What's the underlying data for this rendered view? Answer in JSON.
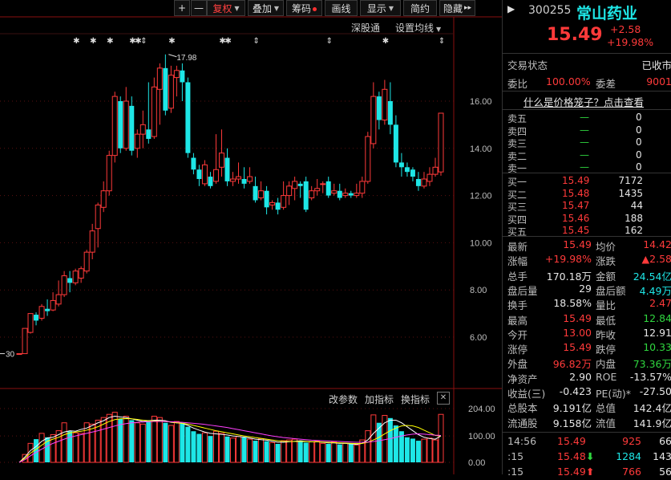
{
  "toolbar": {
    "buttons": [
      {
        "label": "+",
        "name": "zoom-in-button"
      },
      {
        "label": "—",
        "name": "zoom-out-button"
      },
      {
        "label": "复权",
        "name": "adjust-button",
        "caret": true
      },
      {
        "label": "叠加",
        "name": "overlay-button",
        "caret": true
      },
      {
        "label": "筹码",
        "name": "chips-button",
        "dot": true
      },
      {
        "label": "画线",
        "name": "draw-line-button"
      },
      {
        "label": "显示",
        "name": "display-button",
        "caret": true
      },
      {
        "label": "简约",
        "name": "simple-button"
      },
      {
        "label": "隐藏",
        "name": "hide-button",
        "arrows": "▸▸"
      }
    ],
    "shenzhen_link": "深股通",
    "ma_setting": "设置均线",
    "panel_toggle": "▶"
  },
  "stock": {
    "code": "300255",
    "name": "常山药业",
    "price": "15.49",
    "change": "+2.58",
    "change_pct": "+19.98%"
  },
  "colors": {
    "up": "#ff3a3a",
    "down": "#1ee6e6",
    "flat": "#2fd63f",
    "ma_white": "#ffffff",
    "ma_yellow": "#ffff00",
    "ma_pink": "#ff40ff"
  },
  "status": {
    "trade_state_label": "交易状态",
    "trade_state_value": "已收市",
    "ratio_label": "委比",
    "ratio_value": "100.00%",
    "diff_label": "委差",
    "diff_value": "9001",
    "link_text": "什么是价格笼子？点击查看"
  },
  "order_book": {
    "asks": [
      {
        "label": "卖五",
        "price": "—",
        "vol": "0"
      },
      {
        "label": "卖四",
        "price": "—",
        "vol": "0"
      },
      {
        "label": "卖三",
        "price": "—",
        "vol": "0"
      },
      {
        "label": "卖二",
        "price": "—",
        "vol": "0"
      },
      {
        "label": "卖一",
        "price": "—",
        "vol": "0"
      }
    ],
    "bids": [
      {
        "label": "买一",
        "price": "15.49",
        "vol": "7172"
      },
      {
        "label": "买二",
        "price": "15.48",
        "vol": "1435"
      },
      {
        "label": "买三",
        "price": "15.47",
        "vol": "44"
      },
      {
        "label": "买四",
        "price": "15.46",
        "vol": "188"
      },
      {
        "label": "买五",
        "price": "15.45",
        "vol": "162"
      }
    ]
  },
  "stats": [
    {
      "l1": "最新",
      "v1": "15.49",
      "c1": "red",
      "l2": "均价",
      "v2": "14.42",
      "c2": "red"
    },
    {
      "l1": "涨幅",
      "v1": "+19.98%",
      "c1": "red",
      "l2": "涨跌",
      "v2": "▲2.58",
      "c2": "red"
    },
    {
      "l1": "总手",
      "v1": "170.18万",
      "c1": "white",
      "l2": "金额",
      "v2": "24.54亿",
      "c2": "cyan"
    },
    {
      "l1": "盘后量",
      "v1": "29",
      "c1": "white",
      "l2": "盘后额",
      "v2": "4.49万",
      "c2": "cyan"
    },
    {
      "l1": "换手",
      "v1": "18.58%",
      "c1": "white",
      "l2": "量比",
      "v2": "2.47",
      "c2": "red"
    },
    {
      "l1": "最高",
      "v1": "15.49",
      "c1": "red",
      "l2": "最低",
      "v2": "12.84",
      "c2": "green"
    },
    {
      "l1": "今开",
      "v1": "13.00",
      "c1": "red",
      "l2": "昨收",
      "v2": "12.91",
      "c2": "white"
    },
    {
      "l1": "涨停",
      "v1": "15.49",
      "c1": "red",
      "l2": "跌停",
      "v2": "10.33",
      "c2": "green"
    },
    {
      "l1": "外盘",
      "v1": "96.82万",
      "c1": "red",
      "l2": "内盘",
      "v2": "73.36万",
      "c2": "green"
    },
    {
      "l1": "净资产",
      "v1": "2.90",
      "c1": "white",
      "l2": "ROE",
      "v2": "-13.57%",
      "c2": "white"
    },
    {
      "l1": "收益(三)",
      "v1": "-0.423",
      "c1": "white",
      "l2": "PE(动)*",
      "v2": "-27.50",
      "c2": "white"
    },
    {
      "l1": "总股本",
      "v1": "9.191亿",
      "c1": "white",
      "l2": "总值",
      "v2": "142.4亿",
      "c2": "white"
    },
    {
      "l1": "流通股",
      "v1": "9.158亿",
      "c1": "white",
      "l2": "流值",
      "v2": "141.9亿",
      "c2": "white"
    }
  ],
  "ticks": [
    {
      "time": "14:56",
      "price": "15.49",
      "vol": "925",
      "num": "66"
    },
    {
      "time": ":15",
      "price": "15.48",
      "arrow": "down",
      "vol": "1284",
      "num": "143"
    },
    {
      "time": ":15",
      "price": "15.49",
      "arrow": "up",
      "vol": "766",
      "num": "56"
    }
  ],
  "chart_data": [
    {
      "type": "candlestick",
      "y_ticks": [
        "16.00",
        "14.00",
        "12.00",
        "10.00",
        "8.00",
        "6.00"
      ],
      "ylim": [
        4.9,
        18.6
      ],
      "annotations": {
        "high_label": "17.98",
        "low_label": "30"
      },
      "candles": [
        [
          5.3,
          5.3,
          5.3,
          5.3
        ],
        [
          5.3,
          6.37,
          6.37,
          5.3
        ],
        [
          6.2,
          7.0,
          7.0,
          6.15
        ],
        [
          6.95,
          6.7,
          7.05,
          6.5
        ],
        [
          6.8,
          7.3,
          7.4,
          6.7
        ],
        [
          7.2,
          7.1,
          7.6,
          6.9
        ],
        [
          7.15,
          7.55,
          7.9,
          7.1
        ],
        [
          7.4,
          7.8,
          8.4,
          7.3
        ],
        [
          7.8,
          8.6,
          8.8,
          7.7
        ],
        [
          8.5,
          8.3,
          8.8,
          7.9
        ],
        [
          8.3,
          8.8,
          8.9,
          8.2
        ],
        [
          8.5,
          8.9,
          9.0,
          8.3
        ],
        [
          8.8,
          9.6,
          9.7,
          8.7
        ],
        [
          9.6,
          10.5,
          10.8,
          9.3
        ],
        [
          10.6,
          11.6,
          11.7,
          9.8
        ],
        [
          11.5,
          12.2,
          12.6,
          11.3
        ],
        [
          12.2,
          13.7,
          13.9,
          12.0
        ],
        [
          13.7,
          16.2,
          16.4,
          13.4
        ],
        [
          16.0,
          14.0,
          16.2,
          13.8
        ],
        [
          14.0,
          16.0,
          16.6,
          13.9
        ],
        [
          15.8,
          13.9,
          16.2,
          13.7
        ],
        [
          14.0,
          14.6,
          14.8,
          13.6
        ],
        [
          14.6,
          15.0,
          15.6,
          14.0
        ],
        [
          14.8,
          14.4,
          16.8,
          14.2
        ],
        [
          14.5,
          16.6,
          17.0,
          14.4
        ],
        [
          16.5,
          17.4,
          17.6,
          15.0
        ],
        [
          17.4,
          15.6,
          17.98,
          15.4
        ],
        [
          15.7,
          17.1,
          17.5,
          15.5
        ],
        [
          17.0,
          17.3,
          17.5,
          16.2
        ],
        [
          17.3,
          16.8,
          17.6,
          16.0
        ],
        [
          16.8,
          13.8,
          17.0,
          13.6
        ],
        [
          13.6,
          13.1,
          13.8,
          12.9
        ],
        [
          13.1,
          12.7,
          13.3,
          12.4
        ],
        [
          12.5,
          13.3,
          13.5,
          12.4
        ],
        [
          12.8,
          12.4,
          13.0,
          12.3
        ],
        [
          12.6,
          13.1,
          14.6,
          12.5
        ],
        [
          13.2,
          13.8,
          14.8,
          12.8
        ],
        [
          13.6,
          12.6,
          14.0,
          12.4
        ],
        [
          12.6,
          12.7,
          13.0,
          12.4
        ],
        [
          12.7,
          12.8,
          13.4,
          12.5
        ],
        [
          12.7,
          12.5,
          13.2,
          12.3
        ],
        [
          12.6,
          12.8,
          13.2,
          12.5
        ],
        [
          12.4,
          11.8,
          12.8,
          11.7
        ],
        [
          11.9,
          12.2,
          12.6,
          11.8
        ],
        [
          12.2,
          11.5,
          12.4,
          11.2
        ],
        [
          11.6,
          11.7,
          11.8,
          11.4
        ],
        [
          11.7,
          11.4,
          11.9,
          11.2
        ],
        [
          11.5,
          12.0,
          12.6,
          11.4
        ],
        [
          12.0,
          12.4,
          12.6,
          11.6
        ],
        [
          12.3,
          12.6,
          12.8,
          11.8
        ],
        [
          12.5,
          12.4,
          12.6,
          11.9
        ],
        [
          12.6,
          11.4,
          12.8,
          11.3
        ],
        [
          11.9,
          12.2,
          12.4,
          11.8
        ],
        [
          12.2,
          12.3,
          12.7,
          12.0
        ],
        [
          12.5,
          12.5,
          12.6,
          12.1
        ],
        [
          12.6,
          12.0,
          12.8,
          11.9
        ],
        [
          12.1,
          12.2,
          12.5,
          12.0
        ],
        [
          12.2,
          11.9,
          12.5,
          11.8
        ],
        [
          12.0,
          12.1,
          12.3,
          11.9
        ],
        [
          12.1,
          12.0,
          12.2,
          11.9
        ],
        [
          12.0,
          12.1,
          12.5,
          11.9
        ],
        [
          12.1,
          12.6,
          12.8,
          11.9
        ],
        [
          12.6,
          14.5,
          14.7,
          12.5
        ],
        [
          14.2,
          16.2,
          16.8,
          14.0
        ],
        [
          16.2,
          15.2,
          16.4,
          14.8
        ],
        [
          15.2,
          16.5,
          16.9,
          15.0
        ],
        [
          16.0,
          15.0,
          16.8,
          14.6
        ],
        [
          15.0,
          13.4,
          15.4,
          13.2
        ],
        [
          13.4,
          13.2,
          13.8,
          12.8
        ],
        [
          13.2,
          13.0,
          13.4,
          12.8
        ],
        [
          13.1,
          12.8,
          13.2,
          12.6
        ],
        [
          12.7,
          12.4,
          13.0,
          12.2
        ],
        [
          12.4,
          12.7,
          13.0,
          12.3
        ],
        [
          12.6,
          12.9,
          13.2,
          12.4
        ],
        [
          12.9,
          13.2,
          13.6,
          12.8
        ],
        [
          13.0,
          15.49,
          15.49,
          12.84
        ]
      ],
      "volume_ticks": [
        "204.00",
        "100.00",
        "0.00"
      ],
      "volume_ylim": [
        0,
        204
      ],
      "volume": [
        0,
        30,
        72,
        88,
        110,
        95,
        105,
        120,
        150,
        118,
        112,
        110,
        150,
        145,
        160,
        170,
        182,
        190,
        165,
        175,
        160,
        150,
        145,
        160,
        175,
        170,
        150,
        140,
        155,
        150,
        135,
        118,
        108,
        112,
        100,
        118,
        110,
        98,
        92,
        98,
        95,
        88,
        82,
        90,
        80,
        75,
        70,
        82,
        85,
        88,
        82,
        75,
        78,
        80,
        72,
        70,
        78,
        68,
        72,
        70,
        66,
        85,
        120,
        180,
        150,
        178,
        168,
        140,
        118,
        95,
        90,
        82,
        88,
        92,
        85,
        182
      ],
      "ma_lines": [
        {
          "name": "MA5",
          "color": "#ffffff",
          "values": [
            0,
            20,
            45,
            60,
            80,
            92,
            95,
            105,
            115,
            120,
            118,
            125,
            130,
            140,
            150,
            158,
            170,
            175,
            172,
            170,
            165,
            160,
            155,
            158,
            160,
            160,
            158,
            152,
            150,
            148,
            140,
            130,
            122,
            115,
            110,
            108,
            106,
            104,
            100,
            98,
            96,
            92,
            88,
            86,
            84,
            80,
            76,
            76,
            78,
            80,
            82,
            80,
            78,
            78,
            76,
            74,
            74,
            72,
            72,
            70,
            68,
            72,
            85,
            110,
            130,
            150,
            160,
            160,
            150,
            135,
            120,
            105,
            95,
            90,
            88,
            100
          ]
        },
        {
          "name": "MA10",
          "color": "#ffff00",
          "values": [
            0,
            15,
            35,
            50,
            65,
            80,
            88,
            95,
            105,
            112,
            115,
            118,
            122,
            128,
            135,
            145,
            155,
            162,
            165,
            166,
            165,
            163,
            160,
            158,
            157,
            156,
            155,
            153,
            150,
            148,
            145,
            140,
            135,
            130,
            125,
            120,
            116,
            112,
            108,
            104,
            100,
            97,
            94,
            91,
            88,
            85,
            82,
            80,
            79,
            79,
            79,
            79,
            78,
            78,
            77,
            76,
            75,
            74,
            73,
            72,
            71,
            72,
            76,
            85,
            95,
            108,
            120,
            130,
            138,
            140,
            138,
            132,
            122,
            112,
            102,
            100
          ]
        },
        {
          "name": "MA20",
          "color": "#ff40ff",
          "values": [
            0,
            10,
            25,
            38,
            50,
            62,
            72,
            80,
            88,
            95,
            100,
            105,
            110,
            115,
            120,
            126,
            132,
            138,
            143,
            147,
            150,
            152,
            153,
            154,
            155,
            155,
            155,
            154,
            153,
            152,
            150,
            148,
            146,
            144,
            141,
            138,
            135,
            132,
            128,
            124,
            120,
            116,
            112,
            108,
            104,
            100,
            97,
            94,
            92,
            90,
            88,
            86,
            84,
            83,
            82,
            81,
            80,
            79,
            78,
            77,
            76,
            76,
            77,
            79,
            82,
            86,
            90,
            95,
            100,
            104,
            107,
            108,
            107,
            105,
            103,
            102
          ]
        }
      ]
    }
  ],
  "indicator_bar": {
    "edit_params": "改参数",
    "add_indicator": "加指标",
    "switch_indicator": "换指标",
    "close": "✕"
  },
  "markers": {
    "star": "✱",
    "arrow": "⇕"
  }
}
